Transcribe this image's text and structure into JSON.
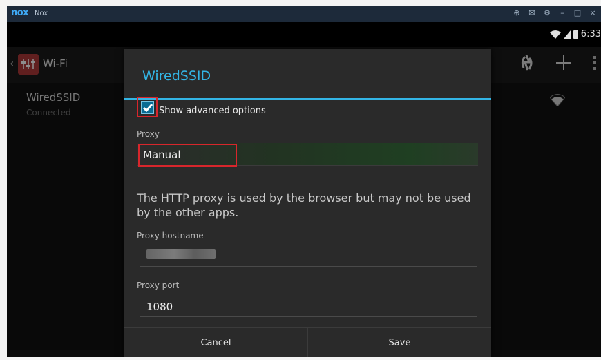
{
  "titlebar": {
    "logo": "nox",
    "app_name": "Nox",
    "controls": [
      "⊕",
      "✉",
      "⚙",
      "–",
      "□",
      "×"
    ]
  },
  "statusbar": {
    "time": "6:33"
  },
  "actionbar": {
    "title": "Wi-Fi",
    "icons": [
      "wps-icon",
      "add-icon",
      "overflow-menu-icon"
    ]
  },
  "wifi_list": {
    "network_name": "WiredSSID",
    "network_status": "Connected"
  },
  "dialog": {
    "title": "WiredSSID",
    "show_advanced_label": "Show advanced options",
    "show_advanced_checked": true,
    "proxy_label": "Proxy",
    "proxy_value": "Manual",
    "proxy_info": "The HTTP proxy is used by the browser but may not be used by the other apps.",
    "hostname_label": "Proxy hostname",
    "port_label": "Proxy port",
    "port_value": "1080",
    "cancel_label": "Cancel",
    "save_label": "Save"
  },
  "colors": {
    "accent": "#33b5e5",
    "highlight": "#d7262c",
    "dialog_bg": "#2a2a2a"
  }
}
